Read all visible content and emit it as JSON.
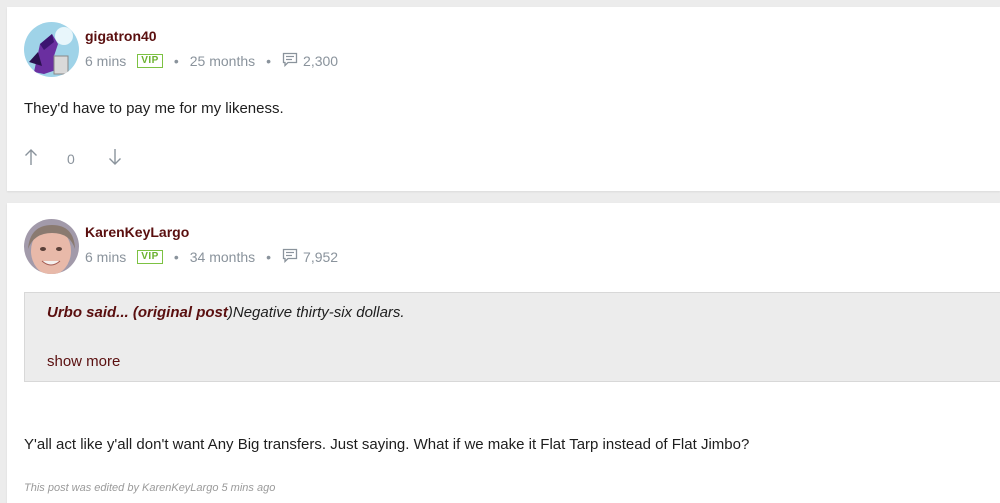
{
  "comments": [
    {
      "username": "gigatron40",
      "time": "6 mins",
      "badge": "VIP",
      "member_duration": "25 months",
      "post_count": "2,300",
      "text": "They'd have to pay me for my likeness.",
      "vote_count": "0"
    },
    {
      "username": "KarenKeyLargo",
      "time": "6 mins",
      "badge": "VIP",
      "member_duration": "34 months",
      "post_count": "7,952",
      "quote": {
        "author": "Urbo said...",
        "link": "(original post",
        "close": ")",
        "text": "Negative thirty-six dollars."
      },
      "show_more": "show more",
      "text": "Y'all act like y'all don't want Any Big transfers. Just saying. What if we make it Flat Tarp instead of Flat Jimbo?",
      "edited_note": "This post was edited by KarenKeyLargo 5 mins ago"
    }
  ],
  "icons": {
    "upvote": "arrow-up-icon",
    "downvote": "arrow-down-icon",
    "posts": "message-icon"
  },
  "colors": {
    "username": "#5a0f0f",
    "vip_border": "#7cc242",
    "meta": "#8a939c"
  }
}
